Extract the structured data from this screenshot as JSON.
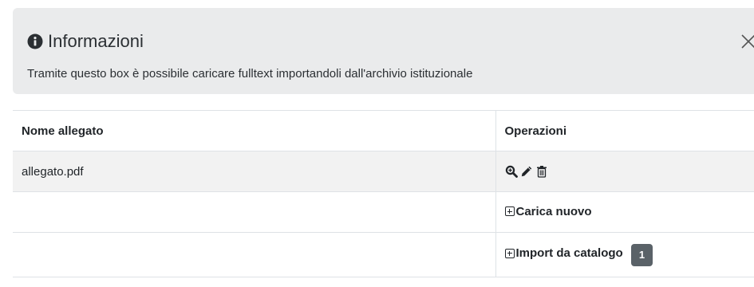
{
  "alert": {
    "icon": "info-circle-icon",
    "title": "Informazioni",
    "text": "Tramite questo box è possibile caricare fulltext importandoli dall'archivio istituzionale",
    "close_icon": "close-icon"
  },
  "table": {
    "headers": [
      "Nome allegato",
      "Operazioni"
    ],
    "rows": [
      {
        "name": "allegato.pdf",
        "icons": [
          "zoom-icon",
          "edit-pencil-icon",
          "trash-icon"
        ]
      }
    ],
    "actions": {
      "upload_label": "Carica nuovo",
      "import_label": "Import da catalogo",
      "import_badge": "1"
    }
  }
}
